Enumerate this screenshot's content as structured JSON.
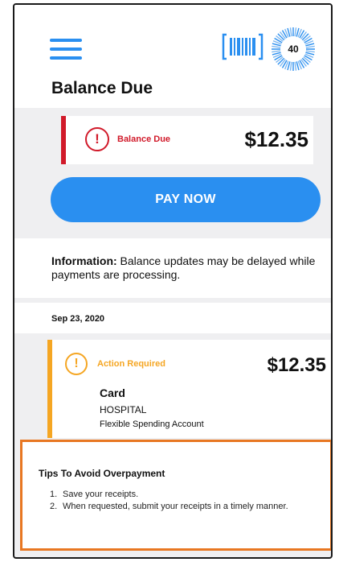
{
  "header": {
    "title": "Balance Due",
    "badge_count": "40",
    "menu_icon": "hamburger-icon",
    "scan_icon": "barcode-icon"
  },
  "balance": {
    "label": "Balance Due",
    "amount": "$12.35",
    "color": "#d11a2a"
  },
  "pay_button": {
    "label": "PAY NOW",
    "color": "#2a8ff0"
  },
  "info": {
    "label": "Information:",
    "text": " Balance updates may be delayed while payments are processing."
  },
  "transactions": [
    {
      "date": "Sep 23, 2020",
      "status": "Action Required",
      "amount": "$12.35",
      "type": "Card",
      "merchant": "HOSPITAL",
      "account": "Flexible Spending Account",
      "color": "#f5a623"
    }
  ],
  "tips": {
    "title": "Tips To Avoid Overpayment",
    "items": [
      {
        "num": "1.",
        "text": "Save your receipts."
      },
      {
        "num": "2.",
        "text": "When requested, submit your receipts in a timely manner."
      }
    ],
    "highlight_color": "#e87722"
  }
}
